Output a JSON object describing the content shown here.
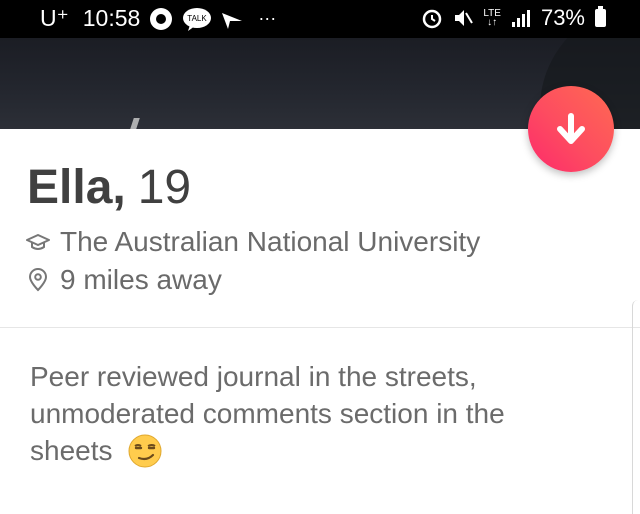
{
  "status_bar": {
    "carrier": "U⁺",
    "time": "10:58",
    "notification_app_label": "TALK",
    "overflow": "···",
    "network": "LTE",
    "battery_percent": "73%"
  },
  "profile": {
    "name": "Ella,",
    "age": "19",
    "school": "The Australian National University",
    "distance": "9 miles away",
    "bio_text": "Peer reviewed journal in the streets, unmoderated comments section in the sheets",
    "bio_emoji": "smirking-face-emoji"
  },
  "icons": {
    "collapse": "arrow-down-icon",
    "school": "graduation-cap-icon",
    "distance": "location-pin-icon"
  },
  "colors": {
    "accent_start": "#fd2a6b",
    "accent_end": "#ff6a52",
    "text_primary": "#404040",
    "text_secondary": "#6a6a6a"
  }
}
